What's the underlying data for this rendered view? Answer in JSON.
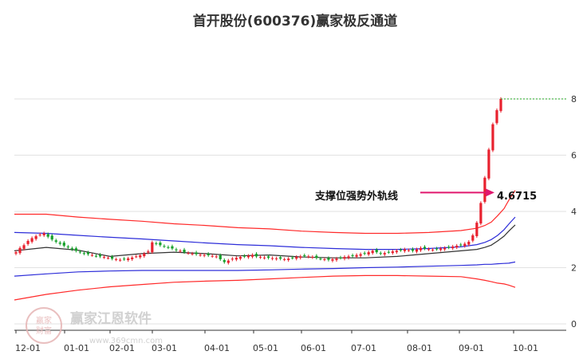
{
  "chart_data": {
    "type": "line",
    "title": "首开股份(600376)赢家极反通道",
    "xlabel": "",
    "ylabel": "",
    "ylim": [
      0,
      8
    ],
    "y_ticks": [
      0,
      2,
      4,
      6,
      8
    ],
    "x_tick_labels": [
      "12-01",
      "01-01",
      "02-01",
      "03-01",
      "04-01",
      "05-01",
      "06-01",
      "07-01",
      "08-01",
      "09-01",
      "10-01"
    ],
    "grid": "horizontal",
    "colors": {
      "up": "#e8212e",
      "down": "#16a02a",
      "outer_band": "#ff2a2a",
      "inner_band": "#2d2dd9",
      "mid_line": "#333333",
      "annotation": "#e0186e",
      "last_line": "#22aa22"
    },
    "annotation": {
      "label": "支撑位强势外轨线",
      "value": "4.6715",
      "y": 4.6715
    },
    "watermark": {
      "logo_top": "赢家",
      "logo_bottom": "财富",
      "name": "赢家江恩软件",
      "url": "www.369cmn.com"
    },
    "series": [
      {
        "role": "outer-upper",
        "x": [
          0,
          40,
          80,
          120,
          160,
          200,
          240,
          280,
          320,
          360,
          400,
          440,
          480,
          520,
          560,
          580,
          590,
          598,
          606,
          614,
          620,
          628
        ],
        "values": [
          3.9,
          3.9,
          3.8,
          3.72,
          3.65,
          3.56,
          3.5,
          3.42,
          3.38,
          3.3,
          3.25,
          3.22,
          3.22,
          3.25,
          3.32,
          3.4,
          3.5,
          3.62,
          3.85,
          4.1,
          4.4,
          4.75
        ]
      },
      {
        "role": "inner-upper",
        "x": [
          0,
          40,
          80,
          120,
          160,
          200,
          240,
          280,
          320,
          360,
          400,
          440,
          480,
          520,
          560,
          580,
          590,
          598,
          606,
          614,
          620,
          628
        ],
        "values": [
          3.25,
          3.22,
          3.15,
          3.08,
          3.02,
          2.95,
          2.88,
          2.82,
          2.78,
          2.72,
          2.68,
          2.65,
          2.65,
          2.68,
          2.74,
          2.82,
          2.9,
          3.0,
          3.15,
          3.35,
          3.55,
          3.8
        ]
      },
      {
        "role": "middle",
        "x": [
          0,
          40,
          80,
          120,
          160,
          200,
          240,
          280,
          320,
          360,
          400,
          440,
          480,
          520,
          560,
          580,
          590,
          598,
          606,
          614,
          620,
          628
        ],
        "values": [
          2.6,
          2.72,
          2.62,
          2.4,
          2.5,
          2.55,
          2.5,
          2.42,
          2.45,
          2.38,
          2.35,
          2.35,
          2.4,
          2.5,
          2.6,
          2.65,
          2.72,
          2.8,
          2.95,
          3.12,
          3.3,
          3.52
        ]
      },
      {
        "role": "inner-lower",
        "x": [
          0,
          40,
          80,
          120,
          160,
          200,
          240,
          280,
          320,
          360,
          400,
          440,
          480,
          520,
          560,
          580,
          590,
          598,
          606,
          614,
          620,
          628
        ],
        "values": [
          1.7,
          1.78,
          1.85,
          1.88,
          1.9,
          1.9,
          1.9,
          1.9,
          1.92,
          1.95,
          1.97,
          2.0,
          2.02,
          2.05,
          2.08,
          2.1,
          2.12,
          2.12,
          2.14,
          2.15,
          2.16,
          2.2
        ]
      },
      {
        "role": "outer-lower",
        "x": [
          0,
          40,
          80,
          120,
          160,
          200,
          240,
          280,
          320,
          360,
          400,
          440,
          480,
          520,
          560,
          580,
          590,
          598,
          606,
          614,
          620,
          628
        ],
        "values": [
          0.85,
          1.05,
          1.2,
          1.32,
          1.4,
          1.48,
          1.52,
          1.55,
          1.6,
          1.65,
          1.7,
          1.72,
          1.72,
          1.7,
          1.68,
          1.6,
          1.55,
          1.5,
          1.45,
          1.42,
          1.38,
          1.3
        ]
      }
    ],
    "candles": {
      "x_start": 20,
      "x_end": 628,
      "closes": [
        2.55,
        2.7,
        2.8,
        2.95,
        3.05,
        3.12,
        3.18,
        3.22,
        3.1,
        3.0,
        2.92,
        2.85,
        2.78,
        2.72,
        2.65,
        2.6,
        2.55,
        2.5,
        2.48,
        2.45,
        2.42,
        2.4,
        2.38,
        2.35,
        2.32,
        2.3,
        2.28,
        2.3,
        2.33,
        2.36,
        2.4,
        2.44,
        2.5,
        2.58,
        2.9,
        2.85,
        2.8,
        2.76,
        2.72,
        2.68,
        2.62,
        2.6,
        2.55,
        2.52,
        2.5,
        2.48,
        2.46,
        2.45,
        2.44,
        2.42,
        2.4,
        2.3,
        2.2,
        2.25,
        2.32,
        2.35,
        2.38,
        2.4,
        2.42,
        2.45,
        2.4,
        2.38,
        2.36,
        2.35,
        2.34,
        2.33,
        2.32,
        2.3,
        2.32,
        2.35,
        2.38,
        2.4,
        2.42,
        2.4,
        2.38,
        2.35,
        2.32,
        2.3,
        2.28,
        2.3,
        2.32,
        2.35,
        2.38,
        2.4,
        2.42,
        2.45,
        2.48,
        2.5,
        2.55,
        2.6,
        2.55,
        2.5,
        2.52,
        2.55,
        2.58,
        2.6,
        2.62,
        2.65,
        2.62,
        2.6,
        2.65,
        2.7,
        2.68,
        2.66,
        2.64,
        2.66,
        2.68,
        2.7,
        2.72,
        2.75,
        2.78,
        2.8,
        2.85,
        2.92,
        3.15,
        3.6,
        4.3,
        5.2,
        6.2,
        7.1,
        7.6,
        8.0
      ]
    },
    "last_value_y": 8.0
  }
}
